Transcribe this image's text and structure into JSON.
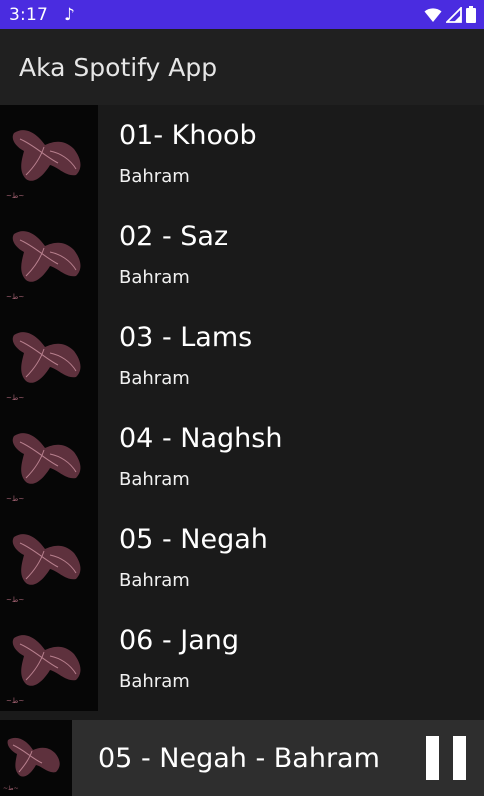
{
  "status_bar": {
    "time": "3:17",
    "notification_icon": "music-note-icon",
    "icons": [
      "wifi-icon",
      "cell-signal-icon",
      "battery-icon"
    ]
  },
  "app_bar": {
    "title": "Aka Spotify App"
  },
  "tracks": [
    {
      "title": "01- Khoob",
      "artist": "Bahram"
    },
    {
      "title": "02 - Saz",
      "artist": "Bahram"
    },
    {
      "title": "03 - Lams",
      "artist": "Bahram"
    },
    {
      "title": "04 - Naghsh",
      "artist": "Bahram"
    },
    {
      "title": "05 - Negah",
      "artist": "Bahram"
    },
    {
      "title": "06 - Jang",
      "artist": "Bahram"
    }
  ],
  "now_playing": {
    "label": "05 - Negah - Bahram",
    "control_icon": "pause-icon"
  },
  "colors": {
    "status_bar": "#4a2ce0",
    "app_bar": "#202020",
    "background": "#1a1a1a",
    "mini_player": "#2e2e2e"
  }
}
